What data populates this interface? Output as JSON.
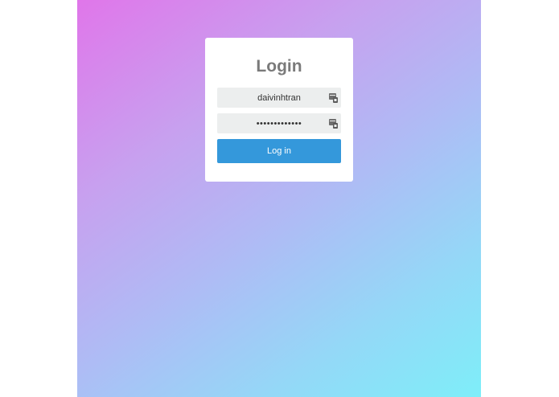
{
  "login": {
    "title": "Login",
    "username": {
      "value": "daivinhtran",
      "icon": "autofill-key-icon"
    },
    "password": {
      "value": "•••••••••••••",
      "icon": "autofill-key-icon"
    },
    "submit_label": "Log in"
  },
  "colors": {
    "gradient_start": "#e076ea",
    "gradient_end": "#7eeef9",
    "button": "#3498db",
    "field_bg": "#eceeee",
    "title": "#7a7a7a"
  }
}
